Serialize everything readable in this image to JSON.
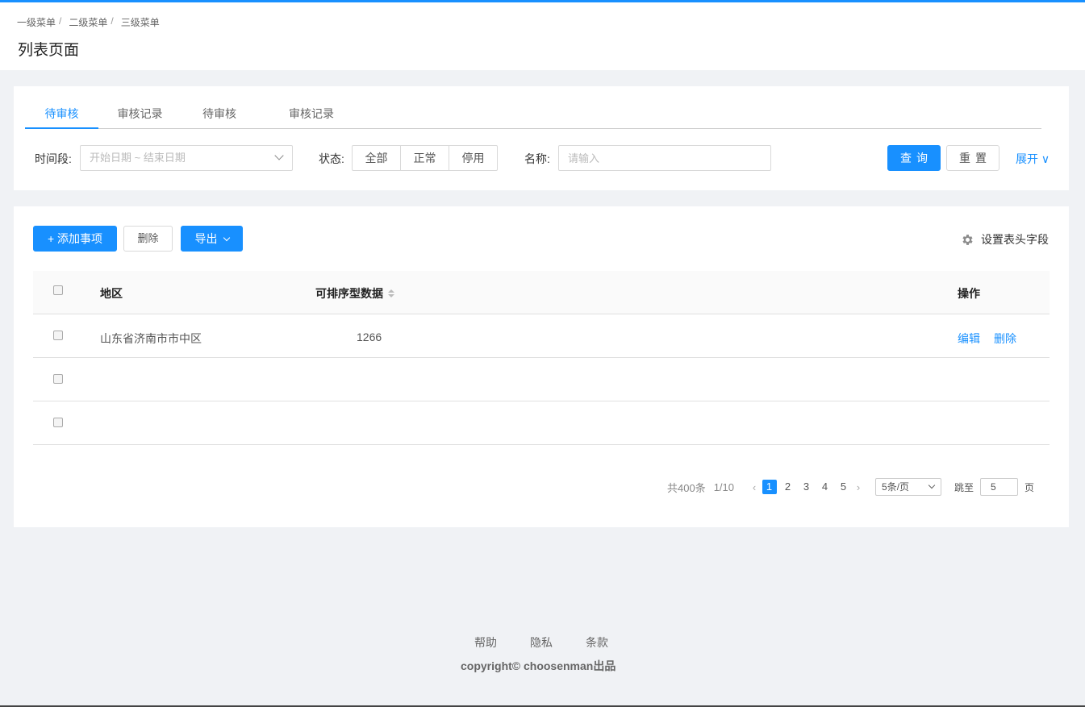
{
  "breadcrumb": [
    "一级菜单",
    "二级菜单",
    "三级菜单"
  ],
  "breadcrumb_sep": "/",
  "page_title": "列表页面",
  "tabs": [
    "待审核",
    "审核记录",
    "待审核",
    "审核记录"
  ],
  "filters": {
    "time_label": "时间段:",
    "date_placeholder": "开始日期 ~ 结束日期",
    "status_label": "状态:",
    "status_options": [
      "全部",
      "正常",
      "停用"
    ],
    "name_label": "名称:",
    "name_placeholder": "请输入",
    "query_label": "查询",
    "reset_label": "重置",
    "expand_label": "展开 ∨"
  },
  "toolbar": {
    "add_label": "+ 添加事项",
    "delete_label": "删除",
    "export_label": "导出",
    "settings_label": "设置表头字段"
  },
  "table": {
    "columns": [
      "地区",
      "可排序型数据",
      "操作"
    ],
    "rows": [
      {
        "region": "山东省济南市市中区",
        "value": "1266",
        "actions": [
          "编辑",
          "删除"
        ]
      },
      {
        "region": "",
        "value": "",
        "actions": []
      },
      {
        "region": "",
        "value": "",
        "actions": []
      }
    ]
  },
  "pagination": {
    "total": "共400条",
    "fraction": "1/10",
    "pages": [
      "1",
      "2",
      "3",
      "4",
      "5"
    ],
    "current": "1",
    "page_size": "5条/页",
    "jump_label": "跳至",
    "jump_value": "5",
    "unit": "页"
  },
  "footer": {
    "links": [
      "帮助",
      "隐私",
      "条款"
    ],
    "copyright": "copyright© choosenman出品"
  },
  "colors": {
    "primary": "#1890ff",
    "background": "#f0f2f5"
  }
}
